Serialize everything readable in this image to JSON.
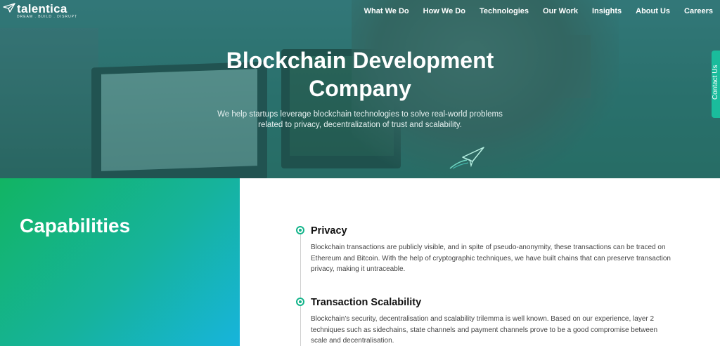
{
  "brand": {
    "name": "talentica",
    "tagline": "DREAM . BUILD . DISRUPT",
    "accent": "#13b48a",
    "gradient_start": "#12b463",
    "gradient_end": "#17b4dc"
  },
  "nav": {
    "items": [
      {
        "label": "What We Do"
      },
      {
        "label": "How We Do"
      },
      {
        "label": "Technologies"
      },
      {
        "label": "Our Work"
      },
      {
        "label": "Insights"
      },
      {
        "label": "About Us"
      },
      {
        "label": "Careers"
      }
    ]
  },
  "hero": {
    "title": "Blockchain Development Company",
    "subtitle": "We help startups leverage blockchain technologies to solve real-world problems related to privacy, decentralization of trust and scalability."
  },
  "contact_tab": {
    "label": "Contact Us"
  },
  "capabilities": {
    "title": "Capabilities",
    "items": [
      {
        "title": "Privacy",
        "description": "Blockchain transactions are publicly visible, and in spite of pseudo-anonymity, these transactions can be traced on Ethereum and Bitcoin. With the help of cryptographic techniques, we have built chains that can preserve transaction privacy, making it untraceable."
      },
      {
        "title": "Transaction Scalability",
        "description": "Blockchain's security, decentralisation and scalability trilemma is well known. Based on our experience, layer 2 techniques such as sidechains, state channels and payment channels prove to be a good compromise between scale and decentralisation."
      }
    ]
  },
  "icons": {
    "logo": "paper-plane-logo-icon",
    "hero_plane": "paper-plane-icon",
    "timeline_dot": "timeline-dot-icon"
  }
}
